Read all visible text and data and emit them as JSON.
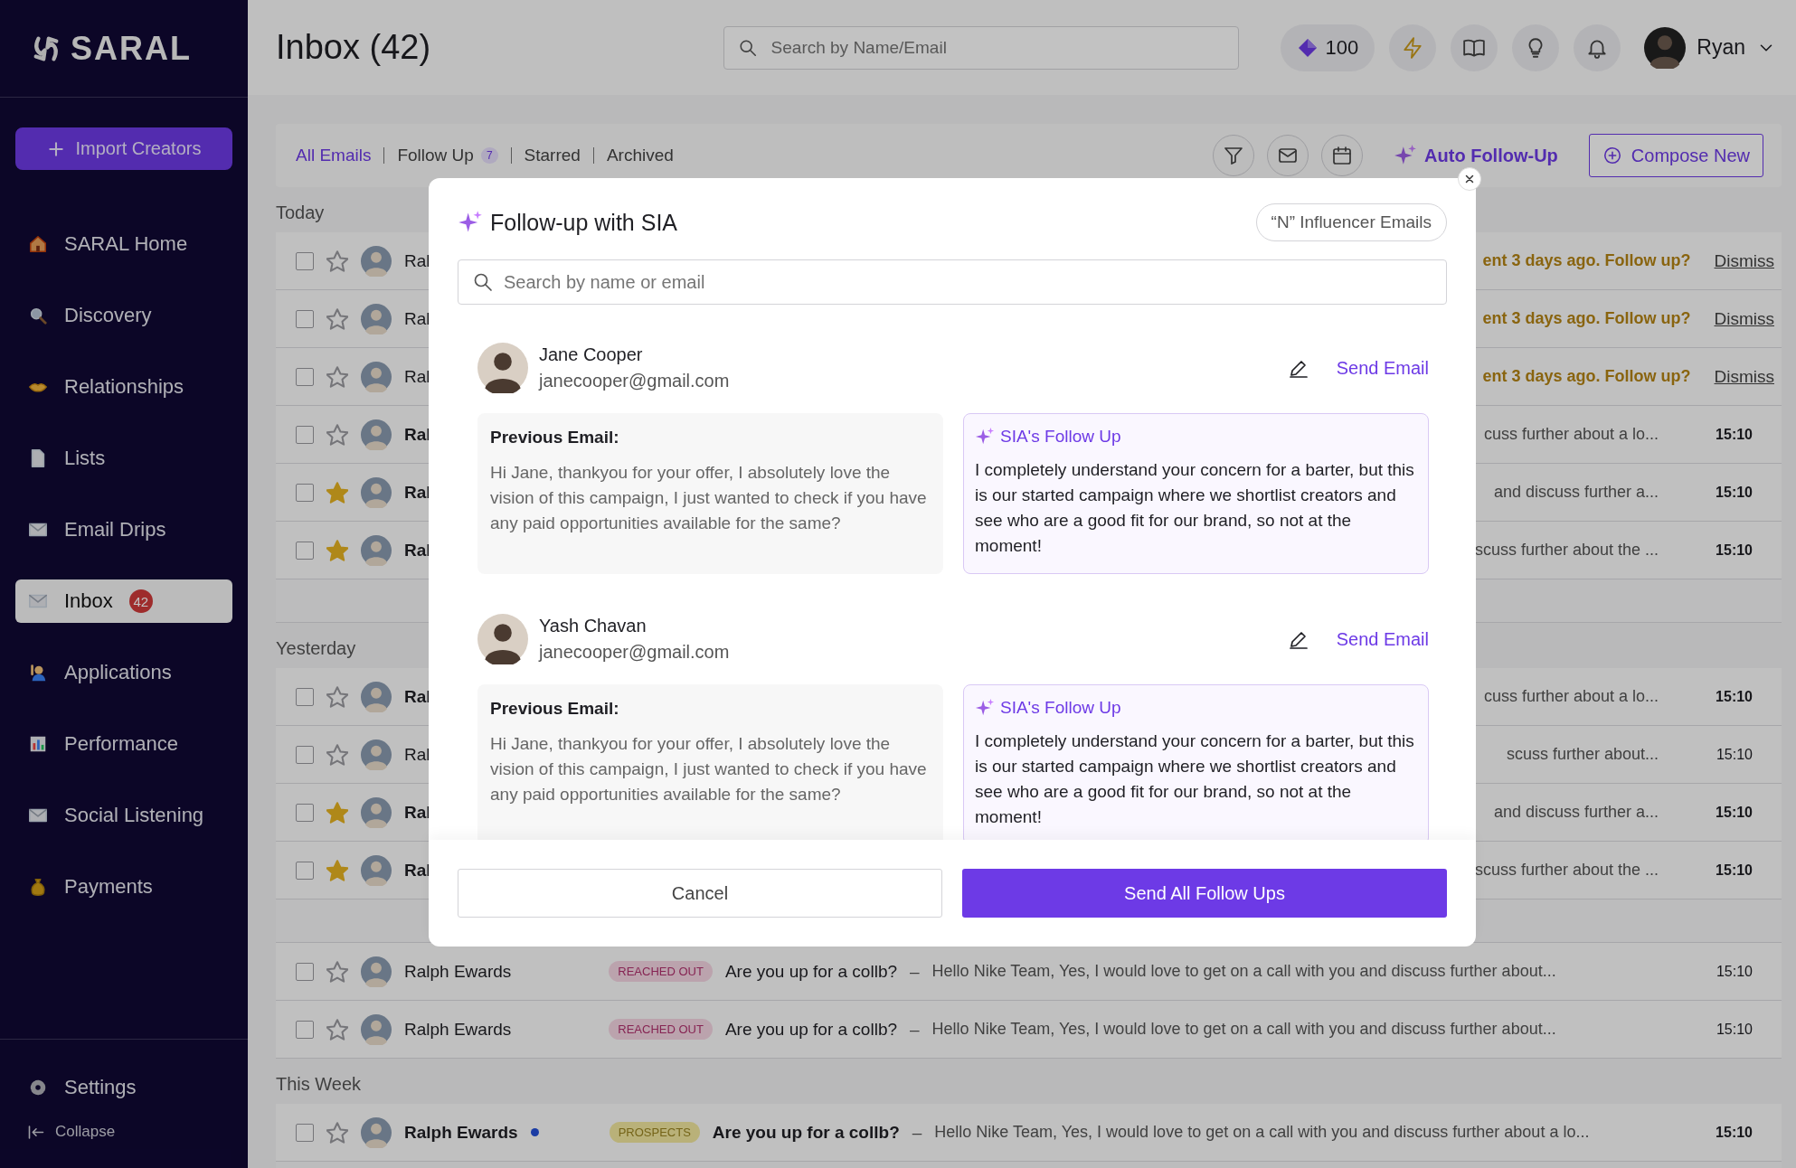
{
  "sidebar": {
    "logo": "SARAL",
    "import_button": "Import Creators",
    "items": [
      {
        "label": "SARAL Home",
        "selected": false
      },
      {
        "label": "Discovery",
        "selected": false
      },
      {
        "label": "Relationships",
        "selected": false
      },
      {
        "label": "Lists",
        "selected": false
      },
      {
        "label": "Email Drips",
        "selected": false
      },
      {
        "label": "Inbox",
        "badge": "42",
        "selected": true
      },
      {
        "label": "Applications",
        "selected": false
      },
      {
        "label": "Performance",
        "selected": false
      },
      {
        "label": "Social Listening",
        "selected": false
      },
      {
        "label": "Payments",
        "selected": false
      }
    ],
    "settings": "Settings",
    "collapse": "Collapse"
  },
  "header": {
    "title": "Inbox (42)",
    "search": {
      "placeholder": "Search by Name/Email"
    },
    "credits": "100",
    "user": "Ryan"
  },
  "toolbar": {
    "tabs": [
      {
        "label": "All Emails",
        "selected": true
      },
      {
        "label": "Follow Up",
        "count": "7",
        "selected": false
      },
      {
        "label": "Starred",
        "selected": false
      },
      {
        "label": "Archived",
        "selected": false
      }
    ],
    "auto_follow_up": "Auto Follow-Up",
    "compose": "Compose New"
  },
  "groups": [
    {
      "label": "Today",
      "rows": [
        {
          "name": "Ral",
          "unread": false,
          "starred": false,
          "checked": false,
          "note": "ent 3 days ago. Follow up?",
          "action": "Dismiss"
        },
        {
          "name": "Ral",
          "unread": false,
          "starred": false,
          "checked": false,
          "note": "ent 3 days ago. Follow up?",
          "action": "Dismiss"
        },
        {
          "name": "Ral",
          "unread": false,
          "starred": false,
          "checked": false,
          "note": "ent 3 days ago. Follow up?",
          "action": "Dismiss"
        },
        {
          "name": "Ral",
          "unread": true,
          "starred": false,
          "checked": false,
          "snippet": "cuss further about a lo...",
          "time": "15:10"
        },
        {
          "name": "Ral",
          "unread": true,
          "starred": true,
          "checked": false,
          "snippet": "and discuss further a...",
          "time": "15:10"
        },
        {
          "name": "Ral",
          "unread": true,
          "starred": true,
          "checked": false,
          "snippet": "scuss further about the ...",
          "time": "15:10"
        }
      ]
    },
    {
      "label": "Yesterday",
      "rows": [
        {
          "name": "Ral",
          "unread": true,
          "starred": false,
          "checked": false,
          "snippet": "cuss further about a lo...",
          "time": "15:10"
        },
        {
          "name": "Ral",
          "unread": false,
          "starred": false,
          "checked": false,
          "snippet": "scuss further about...",
          "time": "15:10"
        },
        {
          "name": "Ral",
          "unread": true,
          "starred": true,
          "checked": false,
          "snippet": "and discuss further a...",
          "time": "15:10"
        },
        {
          "name": "Ral",
          "unread": true,
          "starred": true,
          "checked": false,
          "snippet": "scuss further about the ...",
          "time": "15:10"
        }
      ]
    },
    {
      "rows": [
        {
          "name": "Ralph Ewards",
          "unread": false,
          "starred": false,
          "checked": false,
          "tag": {
            "label": "REACHED OUT",
            "kind": "reached_out"
          },
          "subject": "Are you up for a collb?",
          "dash": "–",
          "snippet": "Hello Nike Team, Yes, I would love to get on a call with you and discuss further about...",
          "time": "15:10"
        },
        {
          "name": "Ralph Ewards",
          "unread": false,
          "starred": false,
          "checked": false,
          "tag": {
            "label": "REACHED OUT",
            "kind": "reached_out"
          },
          "subject": "Are you up for a collb?",
          "dash": "–",
          "snippet": "Hello Nike Team, Yes, I would love to get on a call with you and discuss further about...",
          "time": "15:10"
        }
      ]
    },
    {
      "label": "This Week",
      "rows": [
        {
          "name": "Ralph Ewards",
          "dot": true,
          "unread": true,
          "starred": false,
          "checked": false,
          "tag": {
            "label": "PROSPECTS",
            "kind": "prospects"
          },
          "subject": "Are you up for a collb?",
          "dash": "–",
          "snippet": "Hello Nike Team, Yes, I would love to get on a call with you and discuss further about a lo...",
          "time": "15:10"
        }
      ]
    }
  ],
  "modal": {
    "title": "Follow-up with SIA",
    "count_pill": "“N” Influencer Emails",
    "search": {
      "placeholder": "Search by name or email"
    },
    "items": [
      {
        "name": "Jane Cooper",
        "email": "janecooper@gmail.com",
        "action": "Send Email",
        "previous_label": "Previous Email:",
        "previous_text": "Hi Jane, thankyou for your offer, I absolutely love the vision of this campaign, I just wanted to check if you have any paid opportunities available for the same?",
        "followup_label": "SIA's Follow Up",
        "followup_text": "I completely understand your concern for a barter, but this is our started campaign where we shortlist creators and see who are a good fit for our brand, so not at the moment!"
      },
      {
        "name": "Yash Chavan",
        "email": "janecooper@gmail.com",
        "action": "Send Email",
        "previous_label": "Previous Email:",
        "previous_text": "Hi Jane, thankyou for your offer, I absolutely love the vision of this campaign, I just wanted to check if you have any paid opportunities available for the same?",
        "followup_label": "SIA's Follow Up",
        "followup_text": "I completely understand your concern for a barter, but this is our started campaign where we shortlist creators and see who are a good fit for our brand, so not at the moment!"
      }
    ],
    "cancel": "Cancel",
    "submit": "Send All Follow Ups"
  }
}
